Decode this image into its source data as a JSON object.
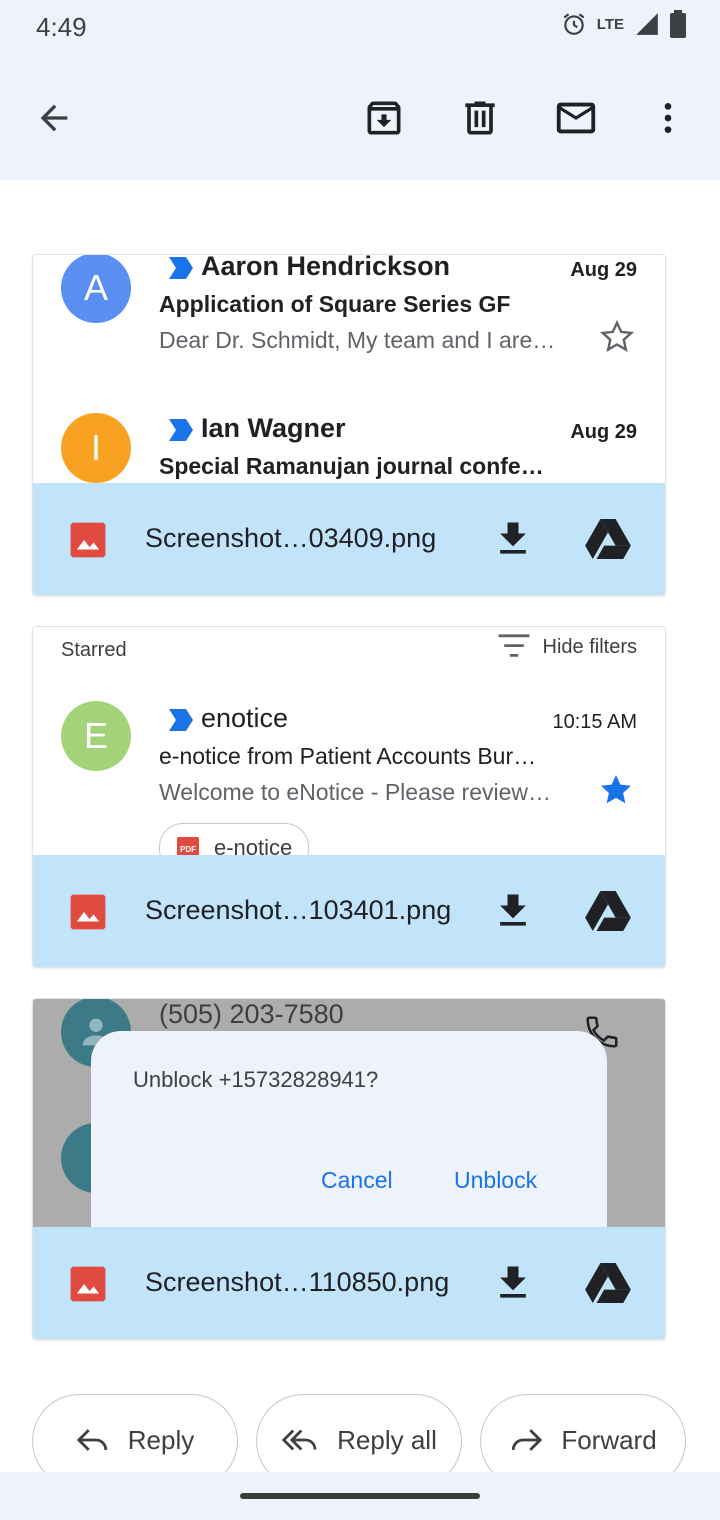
{
  "status": {
    "time": "4:49",
    "network": "LTE",
    "battery": "96"
  },
  "toolbar": {
    "back": "back-arrow-icon",
    "archive": "archive-icon",
    "delete": "delete-icon",
    "mark_unread": "mail-icon",
    "more": "more-vert-icon"
  },
  "attachment1": {
    "emails": [
      {
        "initial": "A",
        "avatar_color": "#5a8ef1",
        "sender": "Aaron Hendrickson",
        "date": "Aug 29",
        "subject": "Application of Square Series GF",
        "snippet": "Dear Dr. Schmidt, My team and I are…",
        "starred": false
      },
      {
        "initial": "I",
        "avatar_color": "#f9a122",
        "sender": "Ian Wagner",
        "date": "Aug 29",
        "subject": "Special Ramanujan journal confe…"
      }
    ],
    "filename": "Screenshot…03409.png"
  },
  "attachment2": {
    "filter_label": "Starred",
    "hide_filters": "Hide filters",
    "email": {
      "initial": "E",
      "avatar_color": "#a3d27a",
      "sender": "enotice",
      "date": "10:15 AM",
      "subject": "e-notice from Patient Accounts Bur…",
      "snippet": "Welcome to eNotice - Please review…",
      "starred": true,
      "chip_label": "e-notice",
      "chip_badge": "PDF"
    },
    "filename": "Screenshot…103401.png"
  },
  "attachment3": {
    "phone": "(505) 203-7580",
    "dialog_title": "Unblock +15732828941?",
    "cancel": "Cancel",
    "unblock": "Unblock",
    "filename": "Screenshot…110850.png"
  },
  "reply_actions": {
    "reply": "Reply",
    "reply_all": "Reply all",
    "forward": "Forward"
  },
  "colors": {
    "accent": "#1a73e8",
    "attachment_bg": "#c2e4fb",
    "toolbar_bg": "#eef2fa",
    "image_icon": "#e04a3f"
  }
}
